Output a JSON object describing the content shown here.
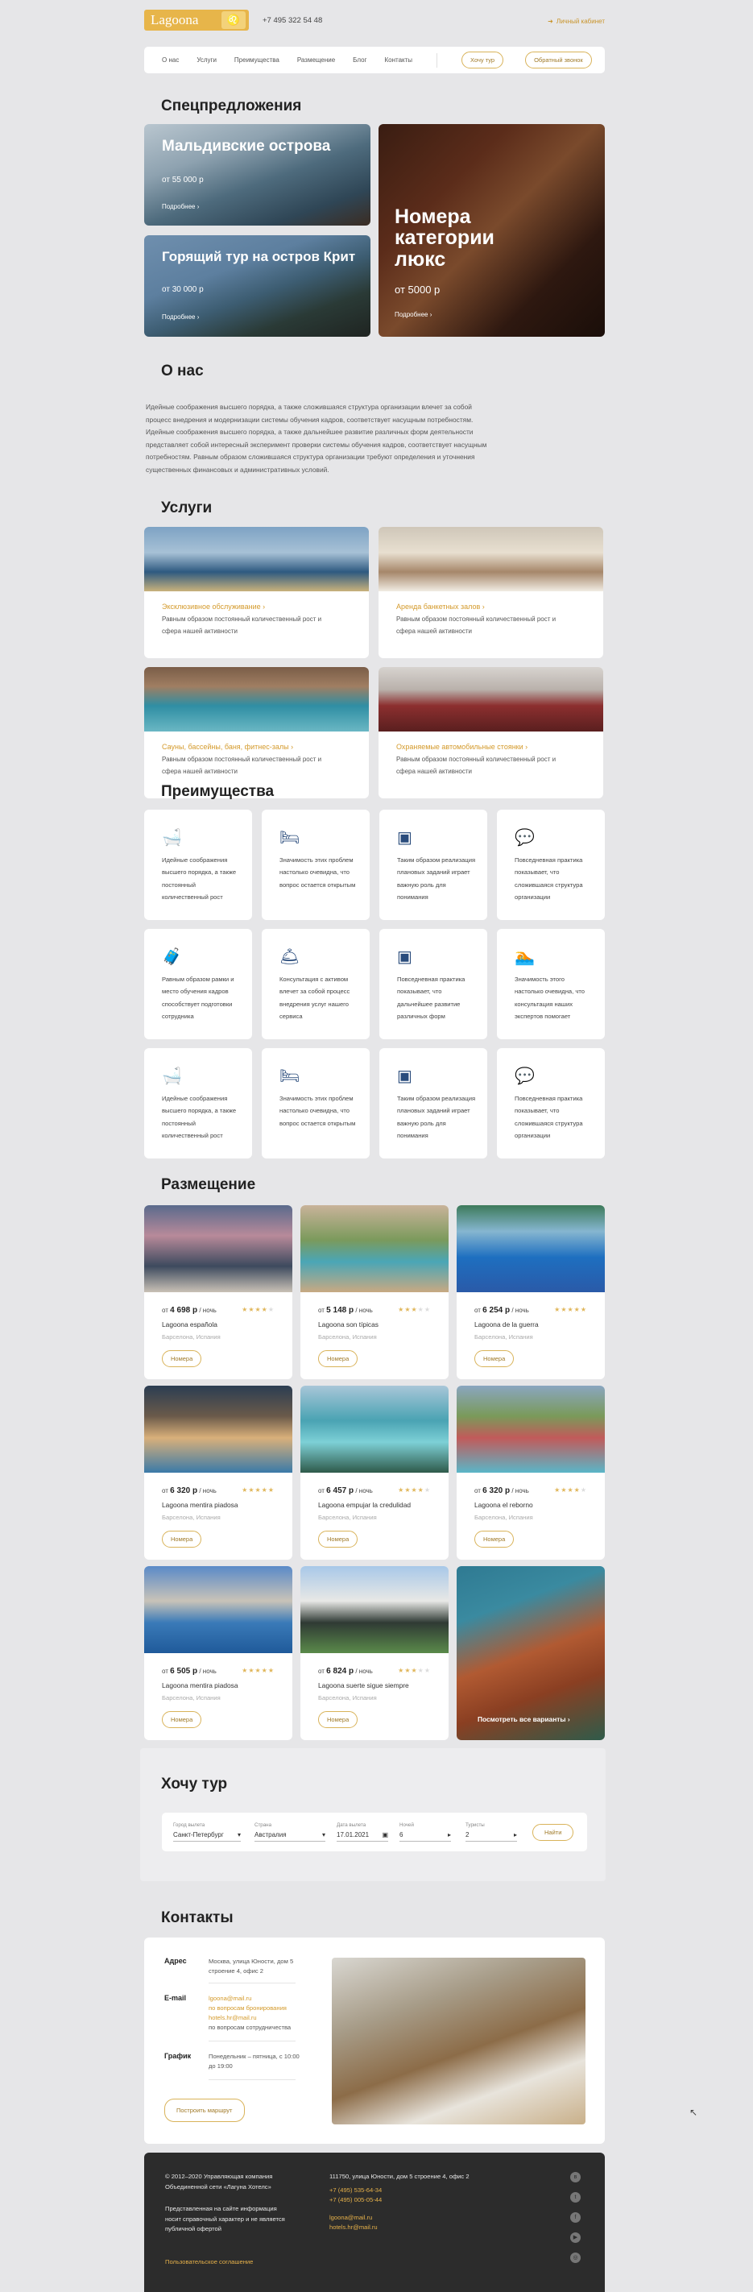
{
  "header": {
    "logo_text": "Lagoona",
    "phone": "+7 495 322 54 48",
    "cabinet": "Личный кабинет"
  },
  "nav": {
    "items": [
      "О нас",
      "Услуги",
      "Преимущества",
      "Размещение",
      "Блог",
      "Контакты"
    ],
    "tour_button": "Хочу тур",
    "callback_button": "Обратный звонок"
  },
  "specials": {
    "heading": "Спецпредложения",
    "cards": [
      {
        "title": "Мальдивские острова",
        "price": "от 55 000 р",
        "more": "Подробнее"
      },
      {
        "title": "Горящий тур на остров Крит",
        "price": "от 30 000 р",
        "more": "Подробнее"
      },
      {
        "title": "Номера категории люкс",
        "price": "от 5000 р",
        "more": "Подробнее"
      }
    ]
  },
  "about": {
    "heading": "О нас",
    "text": "Идейные соображения высшего порядка, а также сложившаяся структура организации влечет за собой процесс внедрения и модернизации системы обучения кадров, соответствует насущным потребностям. Идейные соображения высшего порядка, а также дальнейшее развитие различных форм деятельности представляет собой интересный эксперимент проверки системы обучения кадров, соответствует насущным потребностям. Равным образом сложившаяся структура организации требуют определения и уточнения существенных финансовых и административных условий."
  },
  "services": {
    "heading": "Услуги",
    "items": [
      {
        "title": "Эксклюзивное обслуживание",
        "desc": "Равным образом постоянный количественный рост и сфера нашей активности"
      },
      {
        "title": "Аренда банкетных залов",
        "desc": "Равным образом постоянный количественный рост и сфера нашей активности"
      },
      {
        "title": "Сауны, бассейны, баня, фитнес-залы",
        "desc": "Равным образом постоянный количественный рост и сфера нашей активности"
      },
      {
        "title": "Охраняемые автомобильные стоянки",
        "desc": "Равным образом постоянный количественный рост и сфера нашей активности"
      }
    ]
  },
  "benefits": {
    "heading": "Преимущества",
    "items": [
      {
        "icon": "bathtub-icon",
        "text": "Идейные соображения высшего порядка, а также постоянный количественный рост"
      },
      {
        "icon": "bed-icon",
        "text": "Значимость этих проблем настолько очевидна, что вопрос остается открытым"
      },
      {
        "icon": "tv-icon",
        "text": "Таким образом реализация плановых заданий играет важную роль для понимания"
      },
      {
        "icon": "chat-icon",
        "text": "Повседневная практика показывает, что сложившаяся структура организации"
      },
      {
        "icon": "luggage-icon",
        "text": "Равным образом рамки и место обучения кадров способствует подготовки сотрудника"
      },
      {
        "icon": "service-bell-icon",
        "text": "Консультация с активом влечет за собой процесс внедрения услуг нашего сервиса"
      },
      {
        "icon": "tv-icon",
        "text": "Повседневная практика показывает, что дальнейшее развитие различных форм"
      },
      {
        "icon": "pool-icon",
        "text": "Значимость этого настолько очевидна, что консультация наших экспертов помогает"
      },
      {
        "icon": "bathtub-icon",
        "text": "Идейные соображения высшего порядка, а также постоянный количественный рост"
      },
      {
        "icon": "bed-icon",
        "text": "Значимость этих проблем настолько очевидна, что вопрос остается открытым"
      },
      {
        "icon": "tv-icon",
        "text": "Таким образом реализация плановых заданий играет важную роль для понимания"
      },
      {
        "icon": "chat-icon",
        "text": "Повседневная практика показывает, что сложившаяся структура организации"
      }
    ]
  },
  "hotels": {
    "heading": "Размещение",
    "per_night": "/ ночь",
    "from": "от",
    "button": "Номера",
    "see_all": "Посмотреть все варианты",
    "items": [
      {
        "price": "4 698 р",
        "name": "Lagoona española",
        "location": "Барселона, Испания",
        "rating": 4
      },
      {
        "price": "5 148 р",
        "name": "Lagoona son típicas",
        "location": "Барселона, Испания",
        "rating": 3
      },
      {
        "price": "6 254 р",
        "name": "Lagoona de la guerra",
        "location": "Барселона, Испания",
        "rating": 5
      },
      {
        "price": "6 320 р",
        "name": "Lagoona mentira piadosa",
        "location": "Барселона, Испания",
        "rating": 5
      },
      {
        "price": "6 457 р",
        "name": "Lagoona empujar la credulidad",
        "location": "Барселона, Испания",
        "rating": 4
      },
      {
        "price": "6 320 р",
        "name": "Lagoona el reborno",
        "location": "Барселона, Испания",
        "rating": 4
      },
      {
        "price": "6 505 р",
        "name": "Lagoona mentira piadosa",
        "location": "Барселона, Испания",
        "rating": 5
      },
      {
        "price": "6 824 р",
        "name": "Lagoona suerte sigue siempre",
        "location": "Барселона, Испания",
        "rating": 3
      }
    ]
  },
  "tour": {
    "heading": "Хочу тур",
    "fields": [
      {
        "label": "Город вылета",
        "value": "Санкт-Петербург"
      },
      {
        "label": "Страна",
        "value": "Австралия"
      },
      {
        "label": "Дата вылета",
        "value": "17.01.2021"
      },
      {
        "label": "Ночей",
        "value": "6"
      },
      {
        "label": "Туристы",
        "value": "2"
      }
    ],
    "submit": "Найти"
  },
  "contacts": {
    "heading": "Контакты",
    "address_label": "Адрес",
    "address": "Москва, улица Юности, дом 5 строение 4, офис 2",
    "email_label": "E-mail",
    "emails": [
      {
        "value": "lgoona@mail.ru",
        "note": "по вопросам бронирования"
      },
      {
        "value": "hotels.hr@mail.ru",
        "note": "по вопросам сотрудничества"
      }
    ],
    "schedule_label": "График",
    "schedule": "Понедельник – пятница, с 10:00 до 19:00",
    "route_button": "Построить маршрут"
  },
  "footer": {
    "copyright": "© 2012–2020 Управляющая компания Объединенной сети «Лагуна Хотелс»",
    "disclaimer": "Представленная на сайте информация носит справочный характер и не является публичной офертой",
    "policy": "Пользовательское соглашение",
    "address": "111750, улица Юности, дом 5 строение 4, офис 2",
    "phones": [
      "+7 (495) 535-64-34",
      "+7 (495) 005-05-44"
    ],
    "emails": [
      "lgoona@mail.ru",
      "hotels.hr@mail.ru"
    ],
    "socials": [
      "vk-icon",
      "twitter-icon",
      "facebook-icon",
      "youtube-icon",
      "instagram-icon"
    ]
  },
  "colors": {
    "accent": "#d49a2b",
    "background": "#e6e6e8",
    "footer": "#2c2c2c"
  }
}
